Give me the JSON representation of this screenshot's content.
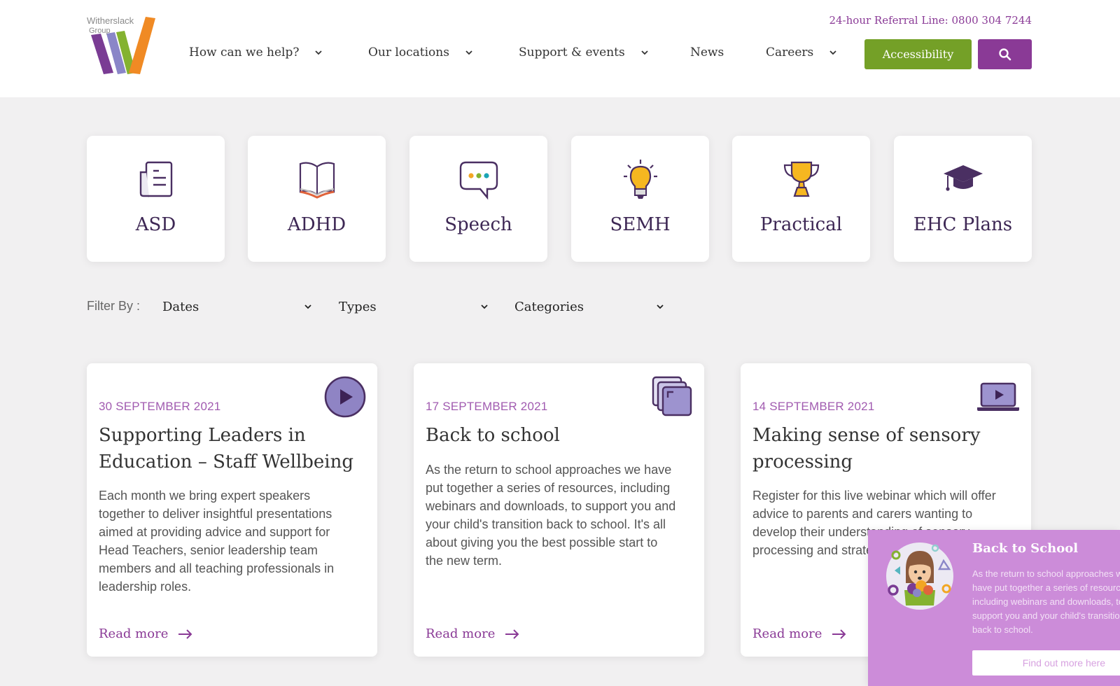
{
  "header": {
    "logo": {
      "line1": "Witherslack",
      "line2": "Group"
    },
    "referral_line": "24-hour Referral Line: 0800 304 7244",
    "nav": [
      {
        "label": "How can we help?",
        "has_dropdown": true
      },
      {
        "label": "Our locations",
        "has_dropdown": true
      },
      {
        "label": "Support & events",
        "has_dropdown": true
      },
      {
        "label": "News",
        "has_dropdown": false
      },
      {
        "label": "Careers",
        "has_dropdown": true
      }
    ],
    "accessibility_label": "Accessibility",
    "search_icon": "search-icon"
  },
  "categories": [
    {
      "label": "ASD",
      "icon": "document-icon"
    },
    {
      "label": "ADHD",
      "icon": "open-book-icon"
    },
    {
      "label": "Speech",
      "icon": "speech-bubble-icon"
    },
    {
      "label": "SEMH",
      "icon": "lightbulb-icon"
    },
    {
      "label": "Practical",
      "icon": "trophy-icon"
    },
    {
      "label": "EHC Plans",
      "icon": "graduation-cap-icon"
    }
  ],
  "filter": {
    "label": "Filter By :",
    "selects": [
      {
        "value": "Dates"
      },
      {
        "value": "Types"
      },
      {
        "value": "Categories"
      }
    ]
  },
  "cards": [
    {
      "date": "30 SEPTEMBER 2021",
      "title": "Supporting Leaders in Education – Staff Wellbeing",
      "description": "Each month we bring expert speakers together to deliver insightful presentations aimed at providing advice and support for Head Teachers, senior leadership team members and all teaching professionals in leadership roles.",
      "type_icon": "play-circle-icon",
      "read_more": "Read more"
    },
    {
      "date": "17 SEPTEMBER 2021",
      "title": "Back to school",
      "description": "As the return to school approaches we have put together a series of resources, including webinars and downloads, to support you and your child's transition back to school. It's all about giving you the best possible start to the new term.",
      "type_icon": "stacked-pages-icon",
      "read_more": "Read more"
    },
    {
      "date": "14 SEPTEMBER 2021",
      "title": "Making sense of sensory processing",
      "description": "Register for this live webinar which will offer advice to parents and carers wanting to develop their understanding of sensory processing and strategies to help their child.",
      "type_icon": "laptop-video-icon",
      "read_more": "Read more"
    }
  ],
  "popup": {
    "title": "Back to School",
    "lines": [
      "As the return to school approaches we",
      "have put together a series of resources,",
      "including webinars and downloads, to",
      "support you and your child's transition",
      "back to school."
    ],
    "button": "Find out more here"
  },
  "colors": {
    "brand_purple": "#8a3a96",
    "accessibility_green": "#74a027",
    "date_purple": "#a15bb0",
    "popup_bg": "#cc8cd9",
    "page_bg": "#f1f0f1"
  }
}
